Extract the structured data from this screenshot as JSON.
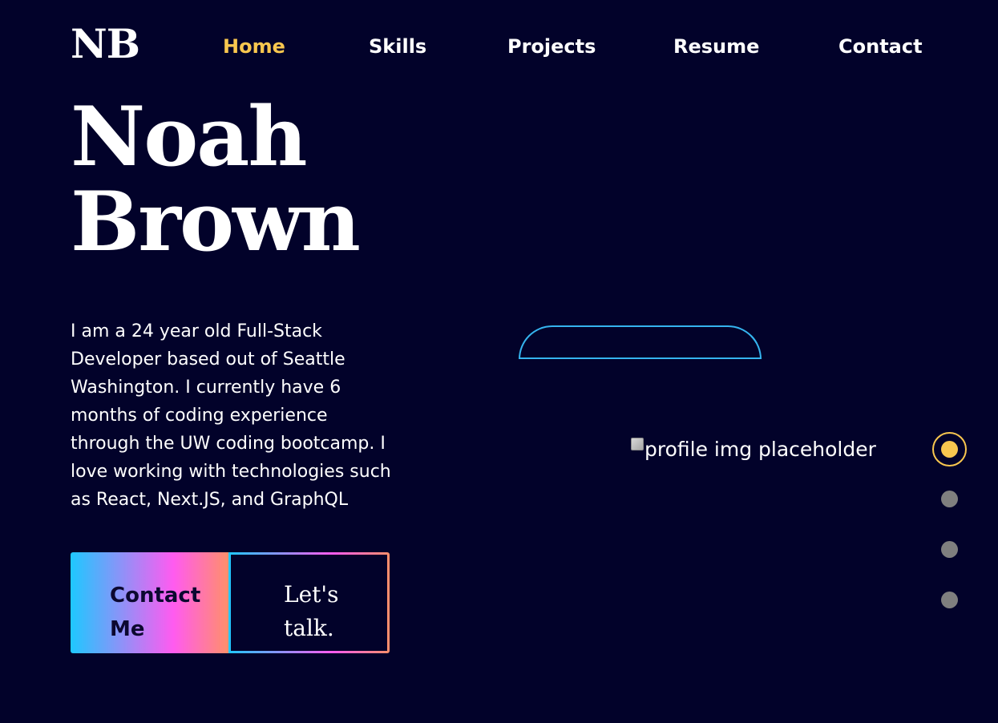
{
  "header": {
    "logo": "NB",
    "nav": [
      {
        "label": "Home",
        "active": true
      },
      {
        "label": "Skills",
        "active": false
      },
      {
        "label": "Projects",
        "active": false
      },
      {
        "label": "Resume",
        "active": false
      },
      {
        "label": "Contact",
        "active": false
      }
    ]
  },
  "hero": {
    "first_name": "Noah",
    "last_name": "Brown",
    "bio": "I am a 24 year old Full-Stack Developer based out of Seattle Washington. I currently have 6 months of coding experience through the UW coding bootcamp. I love working with technologies such as React, Next.JS, and GraphQL",
    "contact_button": "Contact Me",
    "talk_button": "Let's talk."
  },
  "profile": {
    "alt_text": "profile img placeholder"
  },
  "side_nav": {
    "dot_count": 4,
    "active_index": 0
  },
  "colors": {
    "background": "#02022a",
    "accent": "#f9c74f",
    "arc": "#35b4ef",
    "gradient_start": "#1ec8ff",
    "gradient_mid": "#ff5bf0",
    "gradient_end": "#ff8f6a",
    "inactive_dot": "#7f7f7f"
  }
}
